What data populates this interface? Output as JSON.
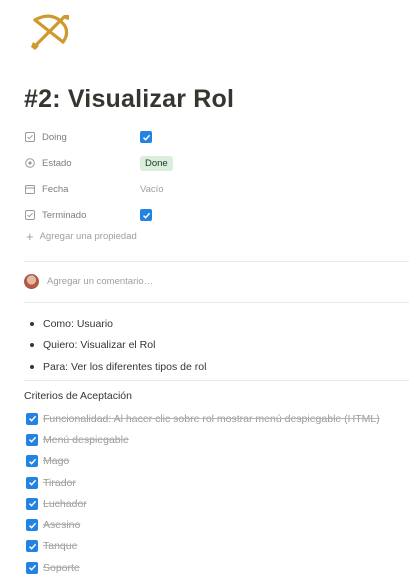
{
  "page": {
    "icon": "bow-and-arrow-icon",
    "title": "#2: Visualizar Rol",
    "accent_color": "#2383e2",
    "icon_color": "#cf9a2c"
  },
  "properties": [
    {
      "name": "Doing",
      "icon": "checkbox-property-icon",
      "type": "checkbox",
      "checked": true
    },
    {
      "name": "Estado",
      "icon": "status-property-icon",
      "type": "status",
      "value": "Done",
      "badge_color": "#dbeddb"
    },
    {
      "name": "Fecha",
      "icon": "calendar-icon",
      "type": "date",
      "value": "Vacío"
    },
    {
      "name": "Terminado",
      "icon": "checkbox-property-icon",
      "type": "checkbox",
      "checked": true
    }
  ],
  "add_property_label": "Agregar una propiedad",
  "comment": {
    "placeholder": "Agregar un comentario…"
  },
  "bullets": [
    "Como: Usuario",
    "Quiero: Visualizar el Rol",
    "Para: Ver los diferentes tipos de rol"
  ],
  "criteria": {
    "heading": "Criterios de Aceptación",
    "items": [
      {
        "text": "Funcionalidad: Al hacer clic sobre rol mostrar menú despiegable (HTML)",
        "checked": true
      },
      {
        "text": "Menú despiegable",
        "checked": true
      },
      {
        "text": "Mago",
        "checked": true
      },
      {
        "text": "Tirador",
        "checked": true
      },
      {
        "text": "Luchador",
        "checked": true
      },
      {
        "text": "Asesino",
        "checked": true
      },
      {
        "text": "Tanque",
        "checked": true
      },
      {
        "text": "Soporte",
        "checked": true
      }
    ]
  }
}
